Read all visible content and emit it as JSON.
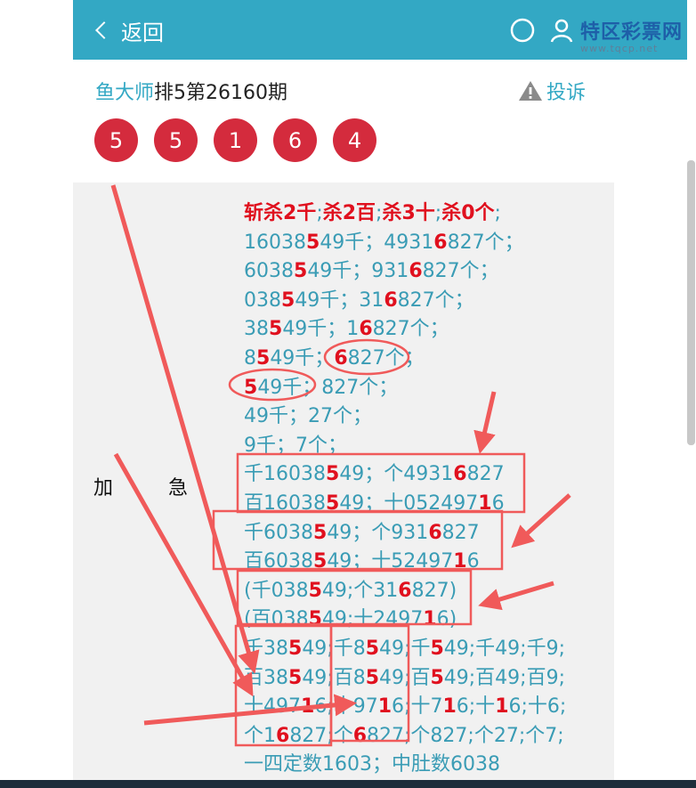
{
  "header": {
    "back_label": "返回",
    "watermark_main": "特区彩票网",
    "watermark_sub": "www.tqcp.net"
  },
  "title": {
    "author": "鱼大师",
    "issue": "排5第26160期",
    "complaint_label": "投诉"
  },
  "balls": [
    "5",
    "5",
    "1",
    "6",
    "4"
  ],
  "side_label": [
    "加",
    "急"
  ],
  "lines": [
    [
      {
        "t": "斩杀2千",
        "c": "hl"
      },
      {
        "t": ";"
      },
      {
        "t": "杀2百",
        "c": "hl"
      },
      {
        "t": ";"
      },
      {
        "t": "杀3十",
        "c": "hl"
      },
      {
        "t": ";"
      },
      {
        "t": "杀0个",
        "c": "hl"
      },
      {
        "t": ";"
      }
    ],
    [
      {
        "t": "16038"
      },
      {
        "t": "5",
        "c": "hl"
      },
      {
        "t": "49千；4931"
      },
      {
        "t": "6",
        "c": "hl"
      },
      {
        "t": "827个；"
      }
    ],
    [
      {
        "t": "6038"
      },
      {
        "t": "5",
        "c": "hl"
      },
      {
        "t": "49千；931"
      },
      {
        "t": "6",
        "c": "hl"
      },
      {
        "t": "827个；"
      }
    ],
    [
      {
        "t": "038"
      },
      {
        "t": "5",
        "c": "hl"
      },
      {
        "t": "49千；31"
      },
      {
        "t": "6",
        "c": "hl"
      },
      {
        "t": "827个；"
      }
    ],
    [
      {
        "t": "38"
      },
      {
        "t": "5",
        "c": "hl"
      },
      {
        "t": "49千；1"
      },
      {
        "t": "6",
        "c": "hl"
      },
      {
        "t": "827个；"
      }
    ],
    [
      {
        "t": "8"
      },
      {
        "t": "5",
        "c": "hl"
      },
      {
        "t": "49千；"
      },
      {
        "t": "6",
        "c": "hl"
      },
      {
        "t": "827个；"
      }
    ],
    [
      {
        "t": "5",
        "c": "hl"
      },
      {
        "t": "49千；827个；"
      }
    ],
    [
      {
        "t": "49千；27个；"
      }
    ],
    [
      {
        "t": "9千；7个；"
      }
    ],
    [
      {
        "t": "千16038"
      },
      {
        "t": "5",
        "c": "hl"
      },
      {
        "t": "49；个4931"
      },
      {
        "t": "6",
        "c": "hl"
      },
      {
        "t": "827"
      }
    ],
    [
      {
        "t": "百16038"
      },
      {
        "t": "5",
        "c": "hl"
      },
      {
        "t": "49；十052497"
      },
      {
        "t": "1",
        "c": "hl"
      },
      {
        "t": "6"
      }
    ],
    [
      {
        "t": "千6038"
      },
      {
        "t": "5",
        "c": "hl"
      },
      {
        "t": "49；个931"
      },
      {
        "t": "6",
        "c": "hl"
      },
      {
        "t": "827"
      }
    ],
    [
      {
        "t": "百6038"
      },
      {
        "t": "5",
        "c": "hl"
      },
      {
        "t": "49；十52497"
      },
      {
        "t": "1",
        "c": "hl"
      },
      {
        "t": "6"
      }
    ],
    [
      {
        "t": "(千038"
      },
      {
        "t": "5",
        "c": "hl"
      },
      {
        "t": "49;个31"
      },
      {
        "t": "6",
        "c": "hl"
      },
      {
        "t": "827)"
      }
    ],
    [
      {
        "t": "(百038"
      },
      {
        "t": "5",
        "c": "hl"
      },
      {
        "t": "49;十2497"
      },
      {
        "t": "1",
        "c": "hl"
      },
      {
        "t": "6)"
      }
    ],
    [
      {
        "t": "千38"
      },
      {
        "t": "5",
        "c": "hl"
      },
      {
        "t": "49;千8"
      },
      {
        "t": "5",
        "c": "hl"
      },
      {
        "t": "49;千"
      },
      {
        "t": "5",
        "c": "hl"
      },
      {
        "t": "49;千49;千9;"
      }
    ],
    [
      {
        "t": "百38"
      },
      {
        "t": "5",
        "c": "hl"
      },
      {
        "t": "49;百8"
      },
      {
        "t": "5",
        "c": "hl"
      },
      {
        "t": "49;百"
      },
      {
        "t": "5",
        "c": "hl"
      },
      {
        "t": "49;百49;百9;"
      }
    ],
    [
      {
        "t": "十497"
      },
      {
        "t": "1",
        "c": "hl"
      },
      {
        "t": "6;十97"
      },
      {
        "t": "1",
        "c": "hl"
      },
      {
        "t": "6;十7"
      },
      {
        "t": "1",
        "c": "hl"
      },
      {
        "t": "6;十"
      },
      {
        "t": "1",
        "c": "hl"
      },
      {
        "t": "6;十6;"
      }
    ],
    [
      {
        "t": "个1"
      },
      {
        "t": "6",
        "c": "hl"
      },
      {
        "t": "827;个"
      },
      {
        "t": "6",
        "c": "hl"
      },
      {
        "t": "827;个827;个27;个7;"
      }
    ],
    [
      {
        "t": "一四定数1603；中肚数6038"
      }
    ]
  ],
  "colors": {
    "header_bg": "#33a8c4",
    "ball_bg": "#d42b3d",
    "accent_text": "#3a9cb5",
    "highlight": "#e0101e",
    "annotation": "#f05a5a"
  }
}
